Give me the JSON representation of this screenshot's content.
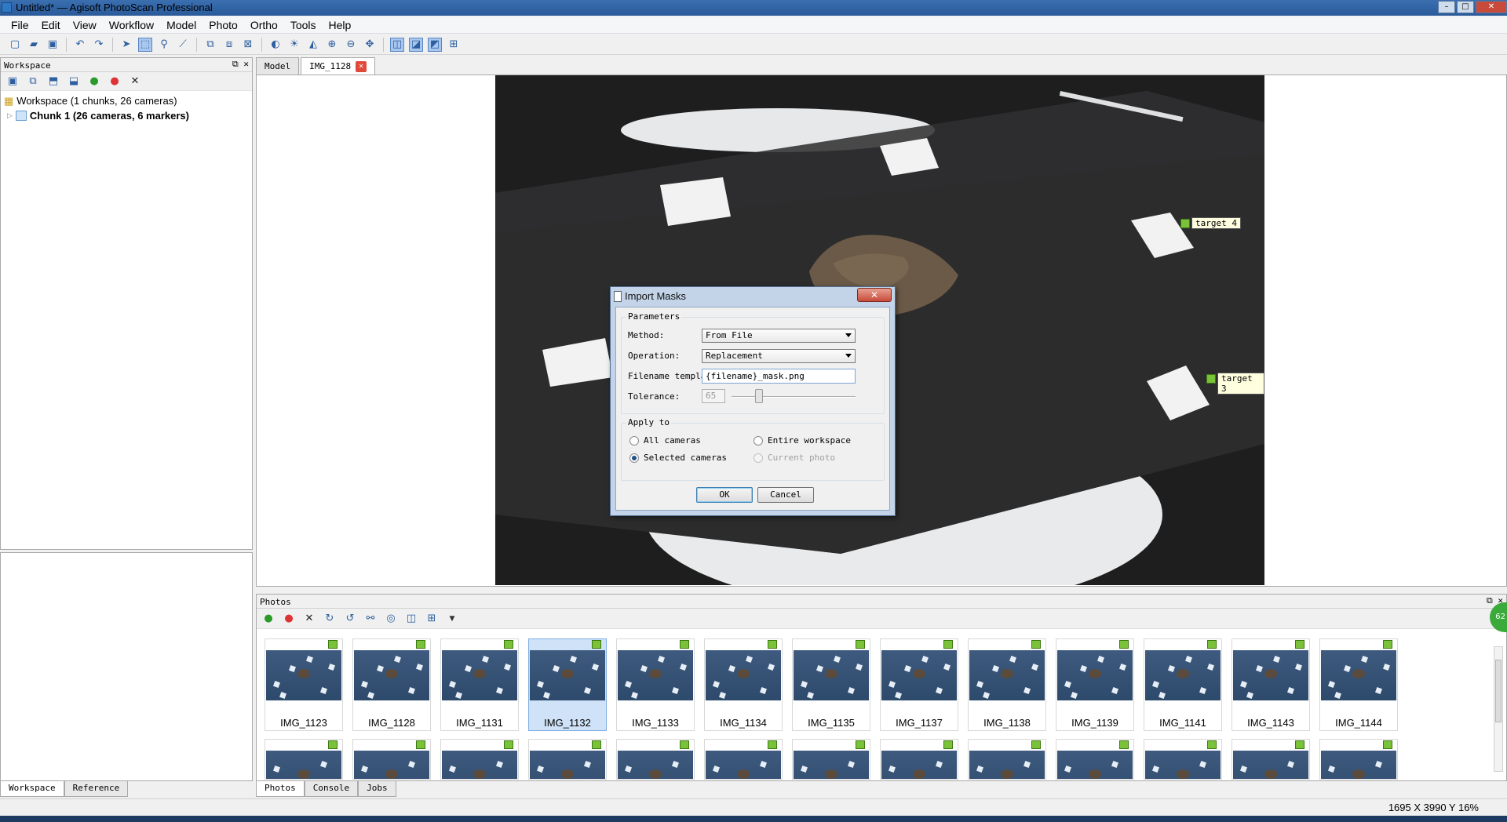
{
  "window": {
    "title": "Untitled* — Agisoft PhotoScan Professional",
    "min": "–",
    "max": "□",
    "close": "✕"
  },
  "menu": [
    "File",
    "Edit",
    "View",
    "Workflow",
    "Model",
    "Photo",
    "Ortho",
    "Tools",
    "Help"
  ],
  "workspace_panel": {
    "title": "Workspace",
    "root": "Workspace (1 chunks, 26 cameras)",
    "chunk": "Chunk 1 (26 cameras, 6 markers)"
  },
  "left_tabs": [
    "Workspace",
    "Reference"
  ],
  "doc_tabs": [
    {
      "label": "Model"
    },
    {
      "label": "IMG_1128"
    }
  ],
  "markers": [
    {
      "label": "target 4"
    },
    {
      "label": "target 3"
    }
  ],
  "dialog": {
    "title": "Import Masks",
    "close": "✕",
    "parameters_title": "Parameters",
    "method_label": "Method:",
    "method_value": "From File",
    "operation_label": "Operation:",
    "operation_value": "Replacement",
    "filename_label": "Filename template:",
    "filename_value": "{filename}_mask.png",
    "tolerance_label": "Tolerance:",
    "tolerance_value": "65",
    "apply_title": "Apply to",
    "all_cameras": "All cameras",
    "selected_cameras": "Selected cameras",
    "entire_workspace": "Entire workspace",
    "current_photo": "Current photo",
    "selected_option": "Selected cameras",
    "ok": "OK",
    "cancel": "Cancel"
  },
  "photos_panel": {
    "title": "Photos",
    "row1": [
      "IMG_1123",
      "IMG_1128",
      "IMG_1131",
      "IMG_1132",
      "IMG_1133",
      "IMG_1134",
      "IMG_1135",
      "IMG_1137",
      "IMG_1138",
      "IMG_1139",
      "IMG_1141",
      "IMG_1143",
      "IMG_1144"
    ],
    "selected": "IMG_1132"
  },
  "bottom_tabs": [
    "Photos",
    "Console",
    "Jobs"
  ],
  "status": "1695 X  3990 Y  16%",
  "badge": "62"
}
